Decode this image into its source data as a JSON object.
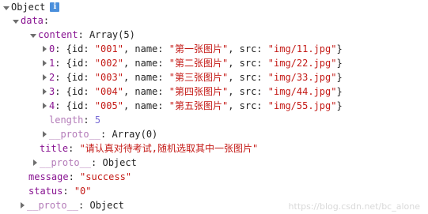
{
  "root": {
    "label": "Object"
  },
  "data_key": "data",
  "content": {
    "key": "content",
    "summary": "Array(5)",
    "items": [
      {
        "index": "0",
        "id": "\"001\"",
        "name": "\"第一张图片\"",
        "src": "\"img/11.jpg\""
      },
      {
        "index": "1",
        "id": "\"002\"",
        "name": "\"第二张图片\"",
        "src": "\"img/22.jpg\""
      },
      {
        "index": "2",
        "id": "\"003\"",
        "name": "\"第三张图片\"",
        "src": "\"img/33.jpg\""
      },
      {
        "index": "3",
        "id": "\"004\"",
        "name": "\"第四张图片\"",
        "src": "\"img/44.jpg\""
      },
      {
        "index": "4",
        "id": "\"005\"",
        "name": "\"第五张图片\"",
        "src": "\"img/55.jpg\""
      }
    ],
    "length_key": "length",
    "length_value": "5",
    "proto_key": "__proto__",
    "proto_value": "Array(0)"
  },
  "title": {
    "key": "title",
    "value": "\"请认真对待考试,随机选取其中一张图片\""
  },
  "data_proto": {
    "key": "__proto__",
    "value": "Object"
  },
  "message": {
    "key": "message",
    "value": "\"success\""
  },
  "status": {
    "key": "status",
    "value": "\"0\""
  },
  "root_proto": {
    "key": "__proto__",
    "value": "Object"
  },
  "watermark": "https://blog.csdn.net/bc_alone"
}
